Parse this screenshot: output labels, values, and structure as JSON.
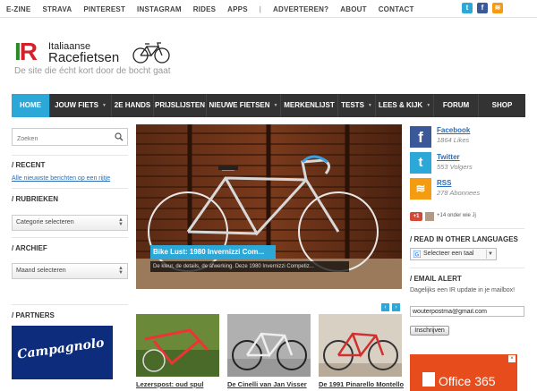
{
  "topnav": {
    "items": [
      "E-ZINE",
      "STRAVA",
      "PINTEREST",
      "INSTAGRAM",
      "RIDES",
      "APPS",
      "|",
      "ADVERTEREN?",
      "ABOUT",
      "CONTACT"
    ]
  },
  "social_top": [
    {
      "icon": "twitter-icon",
      "glyph": "t",
      "color": "#2ba7d8"
    },
    {
      "icon": "facebook-icon",
      "glyph": "f",
      "color": "#3b5998"
    },
    {
      "icon": "rss-icon",
      "glyph": "≋",
      "color": "#f39c12"
    }
  ],
  "logo": {
    "ir_g": "I",
    "ir_r": "R",
    "line1": "Italiaanse",
    "line2": "Racefietsen",
    "tagline": "De site die écht kort door de bocht gaat"
  },
  "mainnav": [
    {
      "label": "HOME",
      "active": true,
      "dropdown": false
    },
    {
      "label": "JOUW FIETS",
      "active": false,
      "dropdown": true
    },
    {
      "label": "2E HANDS",
      "active": false,
      "dropdown": false
    },
    {
      "label": "PRIJSLIJSTEN",
      "active": false,
      "dropdown": false
    },
    {
      "label": "NIEUWE FIETSEN",
      "active": false,
      "dropdown": true
    },
    {
      "label": "MERKENLIJST",
      "active": false,
      "dropdown": false
    },
    {
      "label": "TESTS",
      "active": false,
      "dropdown": true
    },
    {
      "label": "LEES & KIJK",
      "active": false,
      "dropdown": true
    },
    {
      "label": "FORUM",
      "active": false,
      "dropdown": false
    },
    {
      "label": "SHOP",
      "active": false,
      "dropdown": false
    }
  ],
  "sidebar": {
    "search_placeholder": "Zoeken",
    "recent_title": "/ RECENT",
    "recent_link": "Alle nieuwste berichten op een rijtje",
    "rubrieken_title": "/ RUBRIEKEN",
    "rubrieken_select": "Categorie selecteren",
    "archief_title": "/ ARCHIEF",
    "archief_select": "Maand selecteren",
    "partners_title": "/ PARTNERS",
    "partner_name": "Campagnolo"
  },
  "feature": {
    "title": "Bike Lust: 1980 Invernizzi Com...",
    "excerpt": "De kleur, de details, de afwerking. Deze 1980 Invernizzi Competiz...",
    "prev": "‹",
    "next": "›"
  },
  "thumbs": [
    {
      "caption": "Lezerspost: oud spul"
    },
    {
      "caption": "De Cinelli van Jan Visser"
    },
    {
      "caption": "De 1991 Pinarello Montello"
    }
  ],
  "right": {
    "facebook": {
      "name": "Facebook",
      "count": "1864 Likes"
    },
    "twitter": {
      "name": "Twitter",
      "count": "553 Volgers"
    },
    "rss": {
      "name": "RSS",
      "count": "278 Abonnees"
    },
    "gplus_label": "+1",
    "gplus_text": "+14 onder wie",
    "read_title": "/ READ IN OTHER LANGUAGES",
    "translate_label": "Selecteer een taal",
    "alert_title": "/ EMAIL ALERT",
    "alert_text": "Dagelijks een IR update in je mailbox!",
    "email_value": "wouterpostma@gmail.com",
    "subscribe": "Inschrijven",
    "ad_text": "Office 365"
  }
}
